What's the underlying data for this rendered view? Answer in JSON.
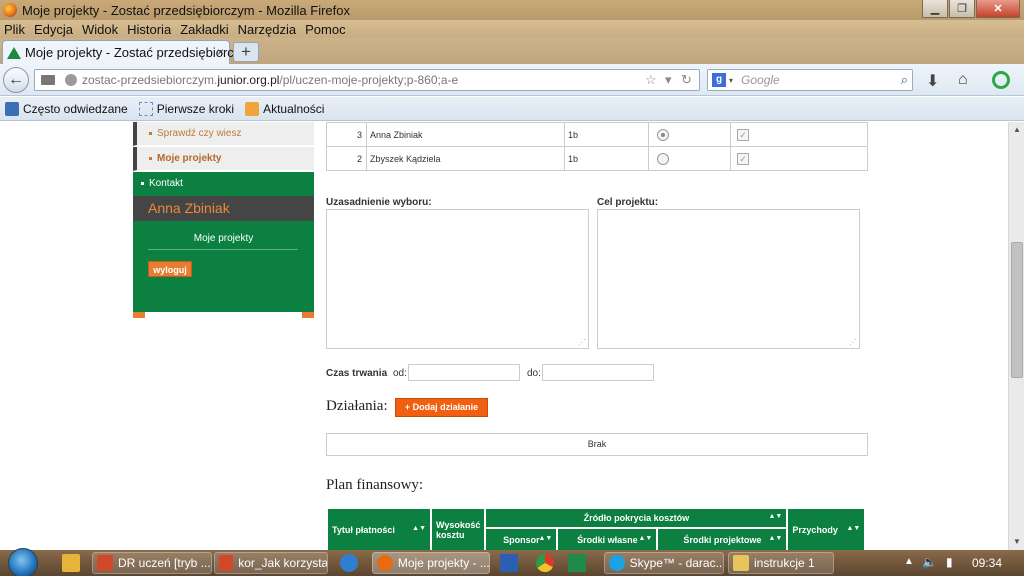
{
  "window": {
    "title": "Moje projekty - Zostać przedsiębiorczym - Mozilla Firefox",
    "controls": [
      "minimize",
      "maximize",
      "close"
    ]
  },
  "menu": [
    "Plik",
    "Edycja",
    "Widok",
    "Historia",
    "Zakładki",
    "Narzędzia",
    "Pomoc"
  ],
  "tabs": [
    {
      "label": "Moje projekty - Zostać przedsiębiorczym",
      "close": "×"
    }
  ],
  "new_tab_label": "+",
  "nav": {
    "url_prefix": "zostac-przedsiebiorczym.",
    "url_domain": "junior.org.pl",
    "url_path": "/pl/uczen-moje-projekty;p-860;a-e",
    "search_placeholder": "Google",
    "search_engine_badge": "g"
  },
  "bookmarks": [
    "Często odwiedzane",
    "Pierwsze kroki",
    "Aktualności"
  ],
  "sidebar": {
    "sub_items": [
      "Sprawdź czy wiesz",
      "Moje projekty"
    ],
    "contact": "Kontakt",
    "user_name": "Anna Zbiniak",
    "user_menu_item": "Moje projekty",
    "logout": "wyloguj"
  },
  "team_table": {
    "rows": [
      {
        "num": "3",
        "name": "Anna Zbiniak",
        "class": "1b",
        "selected": true,
        "checked": true
      },
      {
        "num": "2",
        "name": "Zbyszek Kądziela",
        "class": "1b",
        "selected": false,
        "checked": true
      }
    ]
  },
  "form": {
    "justification_label": "Uzasadnienie wyboru:",
    "goal_label": "Cel projektu:",
    "duration_label": "Czas trwania",
    "from_label": "od:",
    "to_label": "do:"
  },
  "actions": {
    "heading": "Działania:",
    "add_button": "+ Dodaj działanie",
    "empty": "Brak"
  },
  "financial_plan": {
    "heading": "Plan finansowy:",
    "col_title": "Tytuł płatności",
    "col_amount_1": "Wysokość",
    "col_amount_2": "kosztu",
    "col_source": "Źródło pokrycia kosztów",
    "col_sponsor": "Sponsor",
    "col_own": "Środki własne",
    "col_project": "Środki projektowe",
    "col_income": "Przychody"
  },
  "taskbar": {
    "items": [
      "DR uczeń [tryb ...",
      "kor_Jak korzysta...",
      "Moje projekty - ...",
      "Skype™ - darac...",
      "instrukcje 1"
    ],
    "clock": "09:34"
  },
  "colors": {
    "green": "#0c8040",
    "orange": "#e87c30",
    "add_orange": "#f06010",
    "dark_gray": "#454545"
  }
}
